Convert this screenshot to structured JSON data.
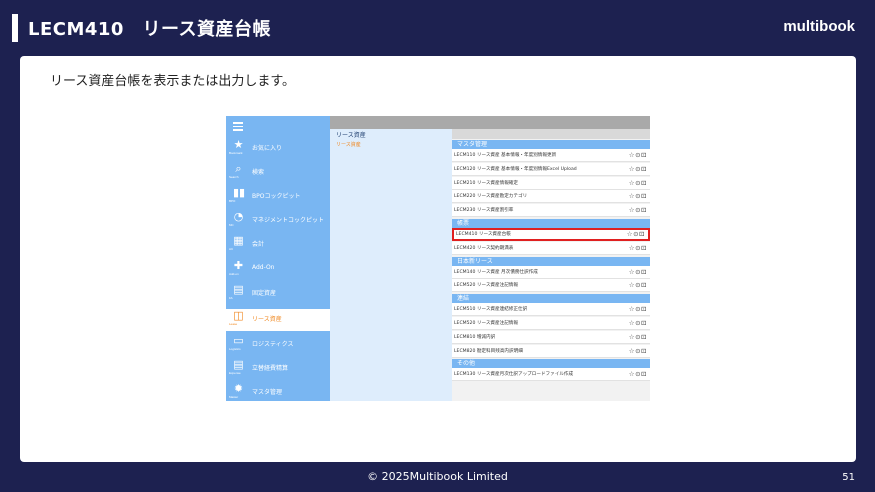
{
  "slide": {
    "title": "LECM410　リース資産台帳",
    "brand": "multibook",
    "description": "リース資産台帳を表示または出力します。",
    "footer": "© 2025Multibook Limited",
    "page_number": "51"
  },
  "app": {
    "nav": [
      {
        "icon": "star-icon",
        "glyph": "★",
        "sub": "Bookmark",
        "label": "お気に入り",
        "active": false
      },
      {
        "icon": "search-icon",
        "glyph": "⌕",
        "sub": "Search",
        "label": "検索",
        "active": false
      },
      {
        "icon": "users-icon",
        "glyph": "▮▮",
        "sub": "BPO",
        "label": "BPOコックピット",
        "active": false
      },
      {
        "icon": "gauge-icon",
        "glyph": "◔",
        "sub": "MC",
        "label": "マネジメントコックピット",
        "active": false
      },
      {
        "icon": "calculator-icon",
        "glyph": "▦",
        "sub": "AC",
        "label": "会計",
        "active": false
      },
      {
        "icon": "addon-icon",
        "glyph": "✚",
        "sub": "Add-on",
        "label": "Add-On",
        "active": false
      },
      {
        "icon": "asset-icon",
        "glyph": "▤",
        "sub": "FA",
        "label": "固定資産",
        "active": false
      },
      {
        "icon": "lease-icon",
        "glyph": "◫",
        "sub": "Lease",
        "label": "リース資産",
        "active": true
      },
      {
        "icon": "truck-icon",
        "glyph": "▭",
        "sub": "Logistics",
        "label": "ロジスティクス",
        "active": false
      },
      {
        "icon": "expense-icon",
        "glyph": "▤",
        "sub": "Expense",
        "label": "立替経費精算",
        "active": false
      },
      {
        "icon": "gear-icon",
        "glyph": "✹",
        "sub": "Master",
        "label": "マスタ管理",
        "active": false
      }
    ],
    "category": {
      "title": "リース資産",
      "selected": "リース資産"
    },
    "sections": [
      {
        "name": "マスタ管理",
        "rows": [
          "LECM110 リース資産 基本情報・年度別情報更新",
          "LECM120 リース資産 基本情報・年度別情報Excel Upload",
          "LECM210 リース資産情報確定",
          "LECM220 リース資産勘定カテゴリ",
          "LECM230 リース資産割引率"
        ]
      },
      {
        "name": "帳票",
        "rows": [
          "LECM410 リース資産台帳",
          "LECM420 リース契約期満表"
        ]
      },
      {
        "name": "日本新リース",
        "rows": [
          "LECM140 リース資産 月次債務仕訳作成",
          "LECM520 リース資産注記情報"
        ]
      },
      {
        "name": "連結",
        "rows": [
          "LECM510 リース資産連結修正仕訳",
          "LECM520 リース資産注記情報",
          "LECM810 増減内訳",
          "LECM820 勘定科目残高内訳明細"
        ]
      },
      {
        "name": "その他",
        "rows": [
          "LECM130 リース資産月次仕訳アップロードファイル作成"
        ]
      }
    ],
    "row_actions": "☆⊙⊡",
    "highlighted_row": "LECM410 リース資産台帳"
  }
}
